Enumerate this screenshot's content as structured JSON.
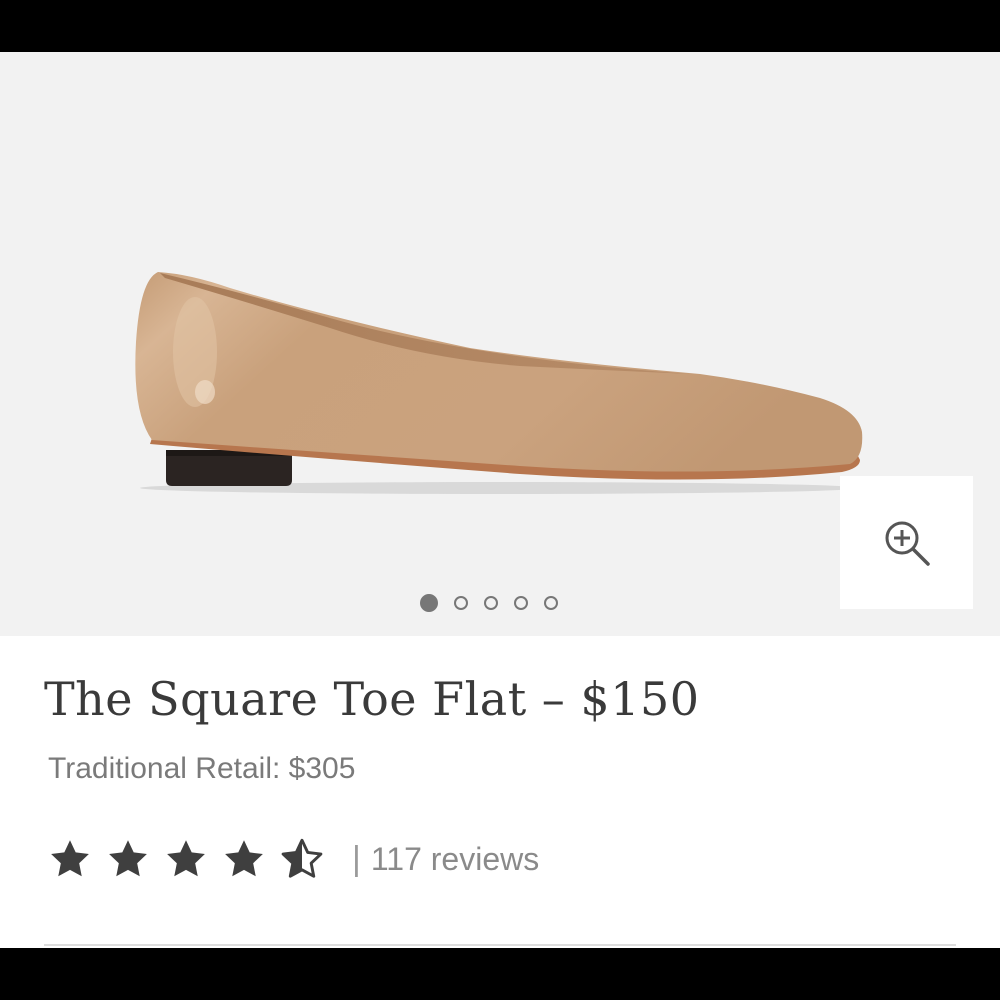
{
  "product": {
    "title": "The Square Toe Flat – $150",
    "retail": "Traditional Retail: $305",
    "rating": 4.5,
    "rating_max": 5,
    "reviews_separator": "|",
    "reviews": "117 reviews"
  },
  "gallery": {
    "slide_count": 5,
    "active_slide": 1,
    "zoom_icon": "zoom-in-icon"
  },
  "colors": {
    "gallery_bg": "#f2f2f2",
    "shoe_leather": "#c79f7b",
    "sole": "#b7764e",
    "heel": "#2b2422",
    "text_dark": "#3a3a3a",
    "star": "#3f3f3f"
  }
}
